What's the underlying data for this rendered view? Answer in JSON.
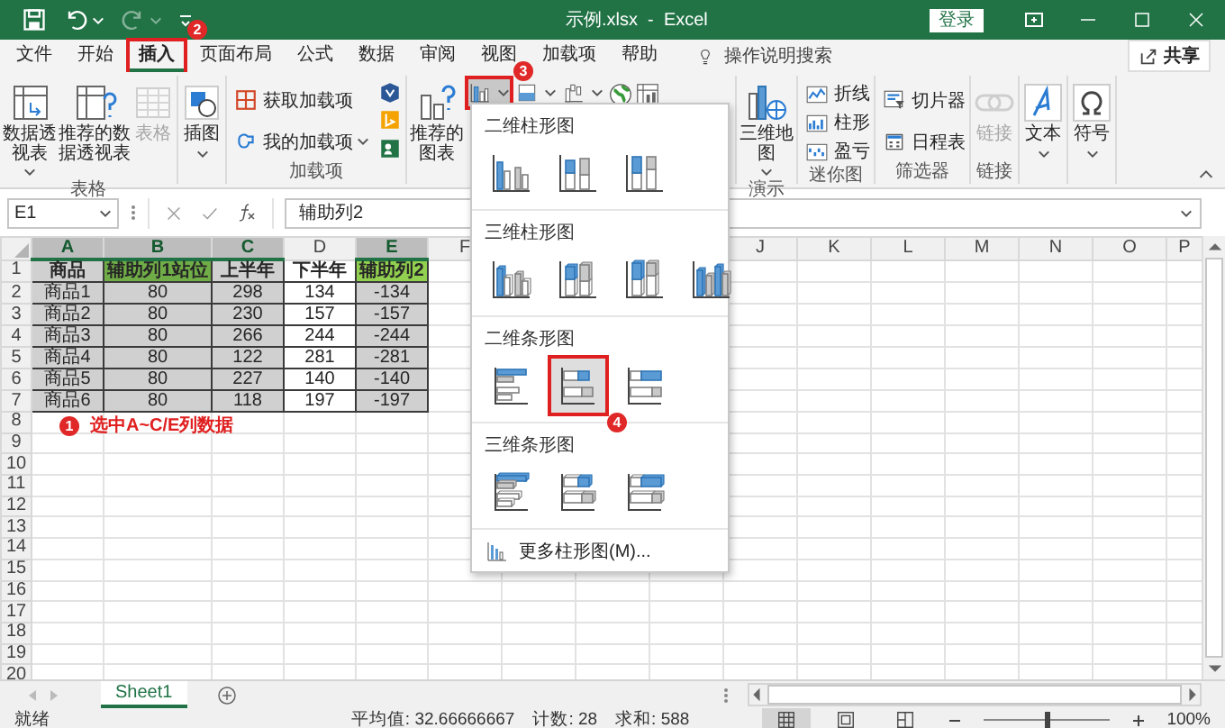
{
  "title_bar": {
    "title": "示例.xlsx  -  Excel",
    "login_button": "登录"
  },
  "menu_tabs": [
    {
      "label": "文件",
      "selected": false
    },
    {
      "label": "开始",
      "selected": false
    },
    {
      "label": "插入",
      "selected": true,
      "callout": "2"
    },
    {
      "label": "页面布局",
      "selected": false
    },
    {
      "label": "公式",
      "selected": false
    },
    {
      "label": "数据",
      "selected": false
    },
    {
      "label": "审阅",
      "selected": false
    },
    {
      "label": "视图",
      "selected": false
    },
    {
      "label": "加载项",
      "selected": false
    },
    {
      "label": "帮助",
      "selected": false
    }
  ],
  "tell_me": "操作说明搜索",
  "share_button": "共享",
  "ribbon_groups": [
    {
      "label": "表格",
      "columns": [
        {
          "kind": "large",
          "buttons": [
            {
              "kind": "pivot-table",
              "label": "数据透视表",
              "dropdown": true,
              "disabled": false
            },
            {
              "kind": "recommended-pivot",
              "label": "推荐的数据透视表",
              "dropdown": false,
              "disabled": false
            },
            {
              "kind": "table",
              "label": "表格",
              "dropdown": false,
              "disabled": true
            }
          ]
        }
      ]
    },
    {
      "columns": [
        {
          "kind": "large",
          "buttons": [
            {
              "kind": "illustrations",
              "label": "插图",
              "dropdown": true,
              "disabled": false
            }
          ]
        }
      ]
    },
    {
      "label": "加载项",
      "columns": [
        {
          "kind": "small",
          "buttons": [
            {
              "kind": "store",
              "label": "获取加载项",
              "dropdown": false,
              "disabled": false
            },
            {
              "kind": "my-addins",
              "label": "我的加载项",
              "dropdown": true,
              "disabled": false
            }
          ]
        },
        {
          "kind": "small",
          "buttons": [
            {
              "kind": "visio",
              "dropdown": false,
              "disabled": false
            },
            {
              "kind": "bing",
              "dropdown": false,
              "disabled": false
            },
            {
              "kind": "people",
              "dropdown": false,
              "disabled": false
            }
          ]
        }
      ]
    },
    {
      "columns": [
        {
          "kind": "large",
          "buttons": [
            {
              "kind": "recommended-charts",
              "label": "推荐的图表",
              "dropdown": false,
              "disabled": false
            }
          ]
        },
        {
          "kind": "row",
          "buttons": [
            {
              "kind": "column-chart",
              "dropdown": true,
              "disabled": false,
              "expanded": true,
              "callout": "3"
            },
            {
              "kind": "combo-chart",
              "dropdown": true,
              "disabled": false,
              "expanded": false
            },
            {
              "kind": "waterfall-chart",
              "dropdown": true,
              "disabled": false,
              "expanded": false
            }
          ]
        },
        {
          "kind": "large",
          "buttons": [
            {
              "kind": "map-chart",
              "dropdown": false,
              "disabled": false
            },
            {
              "kind": "pivot-chart",
              "dropdown": false,
              "disabled": false
            }
          ]
        }
      ]
    },
    {
      "label": "演示",
      "columns": [
        {
          "kind": "large",
          "buttons": [
            {
              "kind": "globemap",
              "label": "三维地图",
              "dropdown": true,
              "disabled": false
            }
          ]
        }
      ]
    },
    {
      "label": "迷你图",
      "columns": [
        {
          "kind": "small",
          "buttons": [
            {
              "kind": "sparkline-line",
              "label": "折线",
              "dropdown": false,
              "disabled": false
            },
            {
              "kind": "sparkline-column",
              "label": "柱形",
              "dropdown": false,
              "disabled": false
            },
            {
              "kind": "sparkline-winloss",
              "label": "盈亏",
              "dropdown": false,
              "disabled": false
            }
          ]
        }
      ]
    },
    {
      "label": "筛选器",
      "columns": [
        {
          "kind": "small",
          "buttons": [
            {
              "kind": "slicer",
              "label": "切片器",
              "dropdown": false,
              "disabled": false
            },
            {
              "kind": "timeline",
              "label": "日程表",
              "dropdown": false,
              "disabled": false
            }
          ]
        }
      ]
    },
    {
      "label": "链接",
      "columns": [
        {
          "kind": "large",
          "buttons": [
            {
              "kind": "link",
              "label": "链接",
              "dropdown": false,
              "disabled": true
            }
          ]
        }
      ]
    },
    {
      "columns": [
        {
          "kind": "large",
          "buttons": [
            {
              "kind": "text",
              "label": "文本",
              "dropdown": true,
              "disabled": false
            }
          ]
        }
      ]
    },
    {
      "columns": [
        {
          "kind": "large",
          "buttons": [
            {
              "kind": "symbol",
              "label": "符号",
              "dropdown": true,
              "disabled": false
            }
          ]
        }
      ]
    }
  ],
  "formula_bar": {
    "name_box": "E1",
    "value": "辅助列2"
  },
  "sheet": {
    "columns": [
      {
        "label": "A",
        "selected": true
      },
      {
        "label": "B",
        "selected": true
      },
      {
        "label": "C",
        "selected": true
      },
      {
        "label": "D",
        "selected": false
      },
      {
        "label": "E",
        "selected": true
      },
      {
        "label": "F",
        "selected": false
      },
      {},
      {},
      {},
      {
        "label": "J",
        "selected": false
      },
      {
        "label": "K",
        "selected": false
      },
      {
        "label": "L",
        "selected": false
      },
      {
        "label": "M",
        "selected": false
      },
      {
        "label": "N",
        "selected": false
      },
      {
        "label": "O",
        "selected": false
      },
      {
        "label": "P",
        "selected": false
      }
    ],
    "row_numbers": [
      "1",
      "2",
      "3",
      "4",
      "5",
      "6",
      "7",
      "8",
      "9",
      "10",
      "11",
      "12",
      "13",
      "14",
      "15",
      "16",
      "17",
      "18",
      "19",
      "20"
    ],
    "rows": [
      [
        {
          "text": "商品"
        },
        {
          "text": "辅助列1站位",
          "color": "#70ad47"
        },
        {
          "text": "上半年"
        },
        {
          "text": "下半年"
        },
        {
          "text": "辅助列2",
          "color": "#92d050"
        }
      ],
      [
        {
          "text": "商品1"
        },
        {
          "text": "80"
        },
        {
          "text": "298"
        },
        {
          "text": "134"
        },
        {
          "text": "-134"
        }
      ],
      [
        {
          "text": "商品2"
        },
        {
          "text": "80"
        },
        {
          "text": "230"
        },
        {
          "text": "157"
        },
        {
          "text": "-157"
        }
      ],
      [
        {
          "text": "商品3"
        },
        {
          "text": "80"
        },
        {
          "text": "266"
        },
        {
          "text": "244"
        },
        {
          "text": "-244"
        }
      ],
      [
        {
          "text": "商品4"
        },
        {
          "text": "80"
        },
        {
          "text": "122"
        },
        {
          "text": "281"
        },
        {
          "text": "-281"
        }
      ],
      [
        {
          "text": "商品5"
        },
        {
          "text": "80"
        },
        {
          "text": "227"
        },
        {
          "text": "140"
        },
        {
          "text": "-140"
        }
      ],
      [
        {
          "text": "商品6"
        },
        {
          "text": "80"
        },
        {
          "text": "118"
        },
        {
          "text": "197"
        },
        {
          "text": "-197"
        }
      ]
    ],
    "note": {
      "number": "1",
      "text": "选中A~C/E列数据"
    }
  },
  "chart_menu": {
    "sections": [
      {
        "title": "二维柱形图",
        "kind": "column-2d",
        "options": [
          {
            "selected": false
          },
          {
            "selected": false
          },
          {
            "selected": false
          }
        ]
      },
      {
        "title": "三维柱形图",
        "kind": "column-3d",
        "options": [
          {
            "selected": false
          },
          {
            "selected": false
          },
          {
            "selected": false
          },
          {
            "selected": false
          }
        ]
      },
      {
        "title": "二维条形图",
        "kind": "bar-2d",
        "options": [
          {
            "selected": false
          },
          {
            "selected": true,
            "callout": "4"
          },
          {
            "selected": false
          }
        ]
      },
      {
        "title": "三维条形图",
        "kind": "bar-3d",
        "options": [
          {
            "selected": false
          },
          {
            "selected": false
          },
          {
            "selected": false
          }
        ]
      }
    ],
    "more": "更多柱形图(M)..."
  },
  "sheet_tabs": [
    {
      "label": "Sheet1",
      "selected": true
    }
  ],
  "status_bar": {
    "ready": "就绪",
    "average": "平均值: 32.66666667",
    "count": "计数: 28",
    "sum": "求和: 588",
    "zoom": "100%",
    "zoom_slider": {
      "level": 0.5
    }
  }
}
